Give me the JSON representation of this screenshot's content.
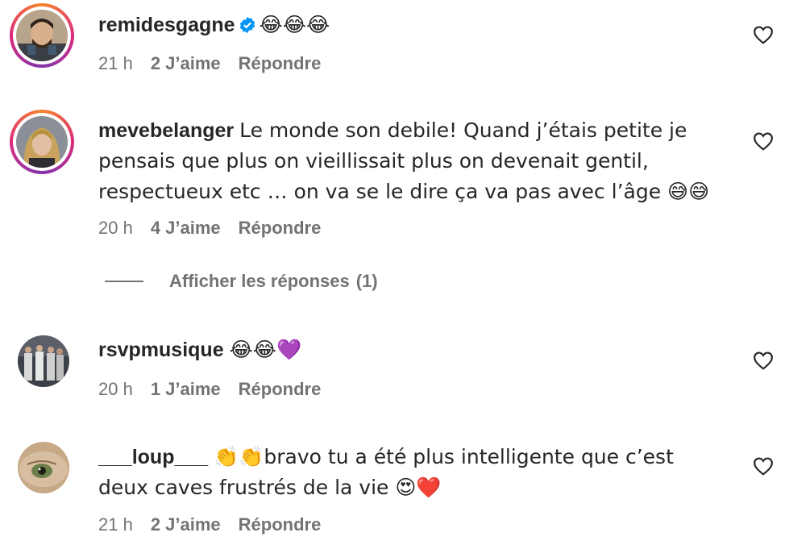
{
  "comments": [
    {
      "username": "remidesgagne",
      "verified": true,
      "text": "😂😂😂",
      "time": "21 h",
      "likes": "2 J’aime",
      "reply": "Répondre"
    },
    {
      "username": "mevebelanger",
      "verified": false,
      "text": "Le monde son debile! Quand j’étais petite je pensais que plus on vieillissait plus on devenait gentil, respectueux etc … on va se le dire ça va pas avec l’âge 😅😅",
      "time": "20 h",
      "likes": "4 J’aime",
      "reply": "Répondre"
    },
    {
      "username": "rsvpmusique",
      "verified": false,
      "text": "😂😂💜",
      "time": "20 h",
      "likes": "1 J’aime",
      "reply": "Répondre"
    },
    {
      "username": "___loup___",
      "verified": false,
      "text": "👏👏bravo tu a été plus intelligente que c’est deux caves frustrés de la vie 😍❤️",
      "time": "21 h",
      "likes": "2 J’aime",
      "reply": "Répondre"
    }
  ],
  "view_replies": {
    "label": "Afficher les réponses",
    "count": "(1)"
  },
  "colors": {
    "text": "#262626",
    "muted": "#737373",
    "verified": "#0095f6"
  },
  "icons": {
    "like": "heart-outline-icon",
    "verified": "verified-badge-icon"
  }
}
